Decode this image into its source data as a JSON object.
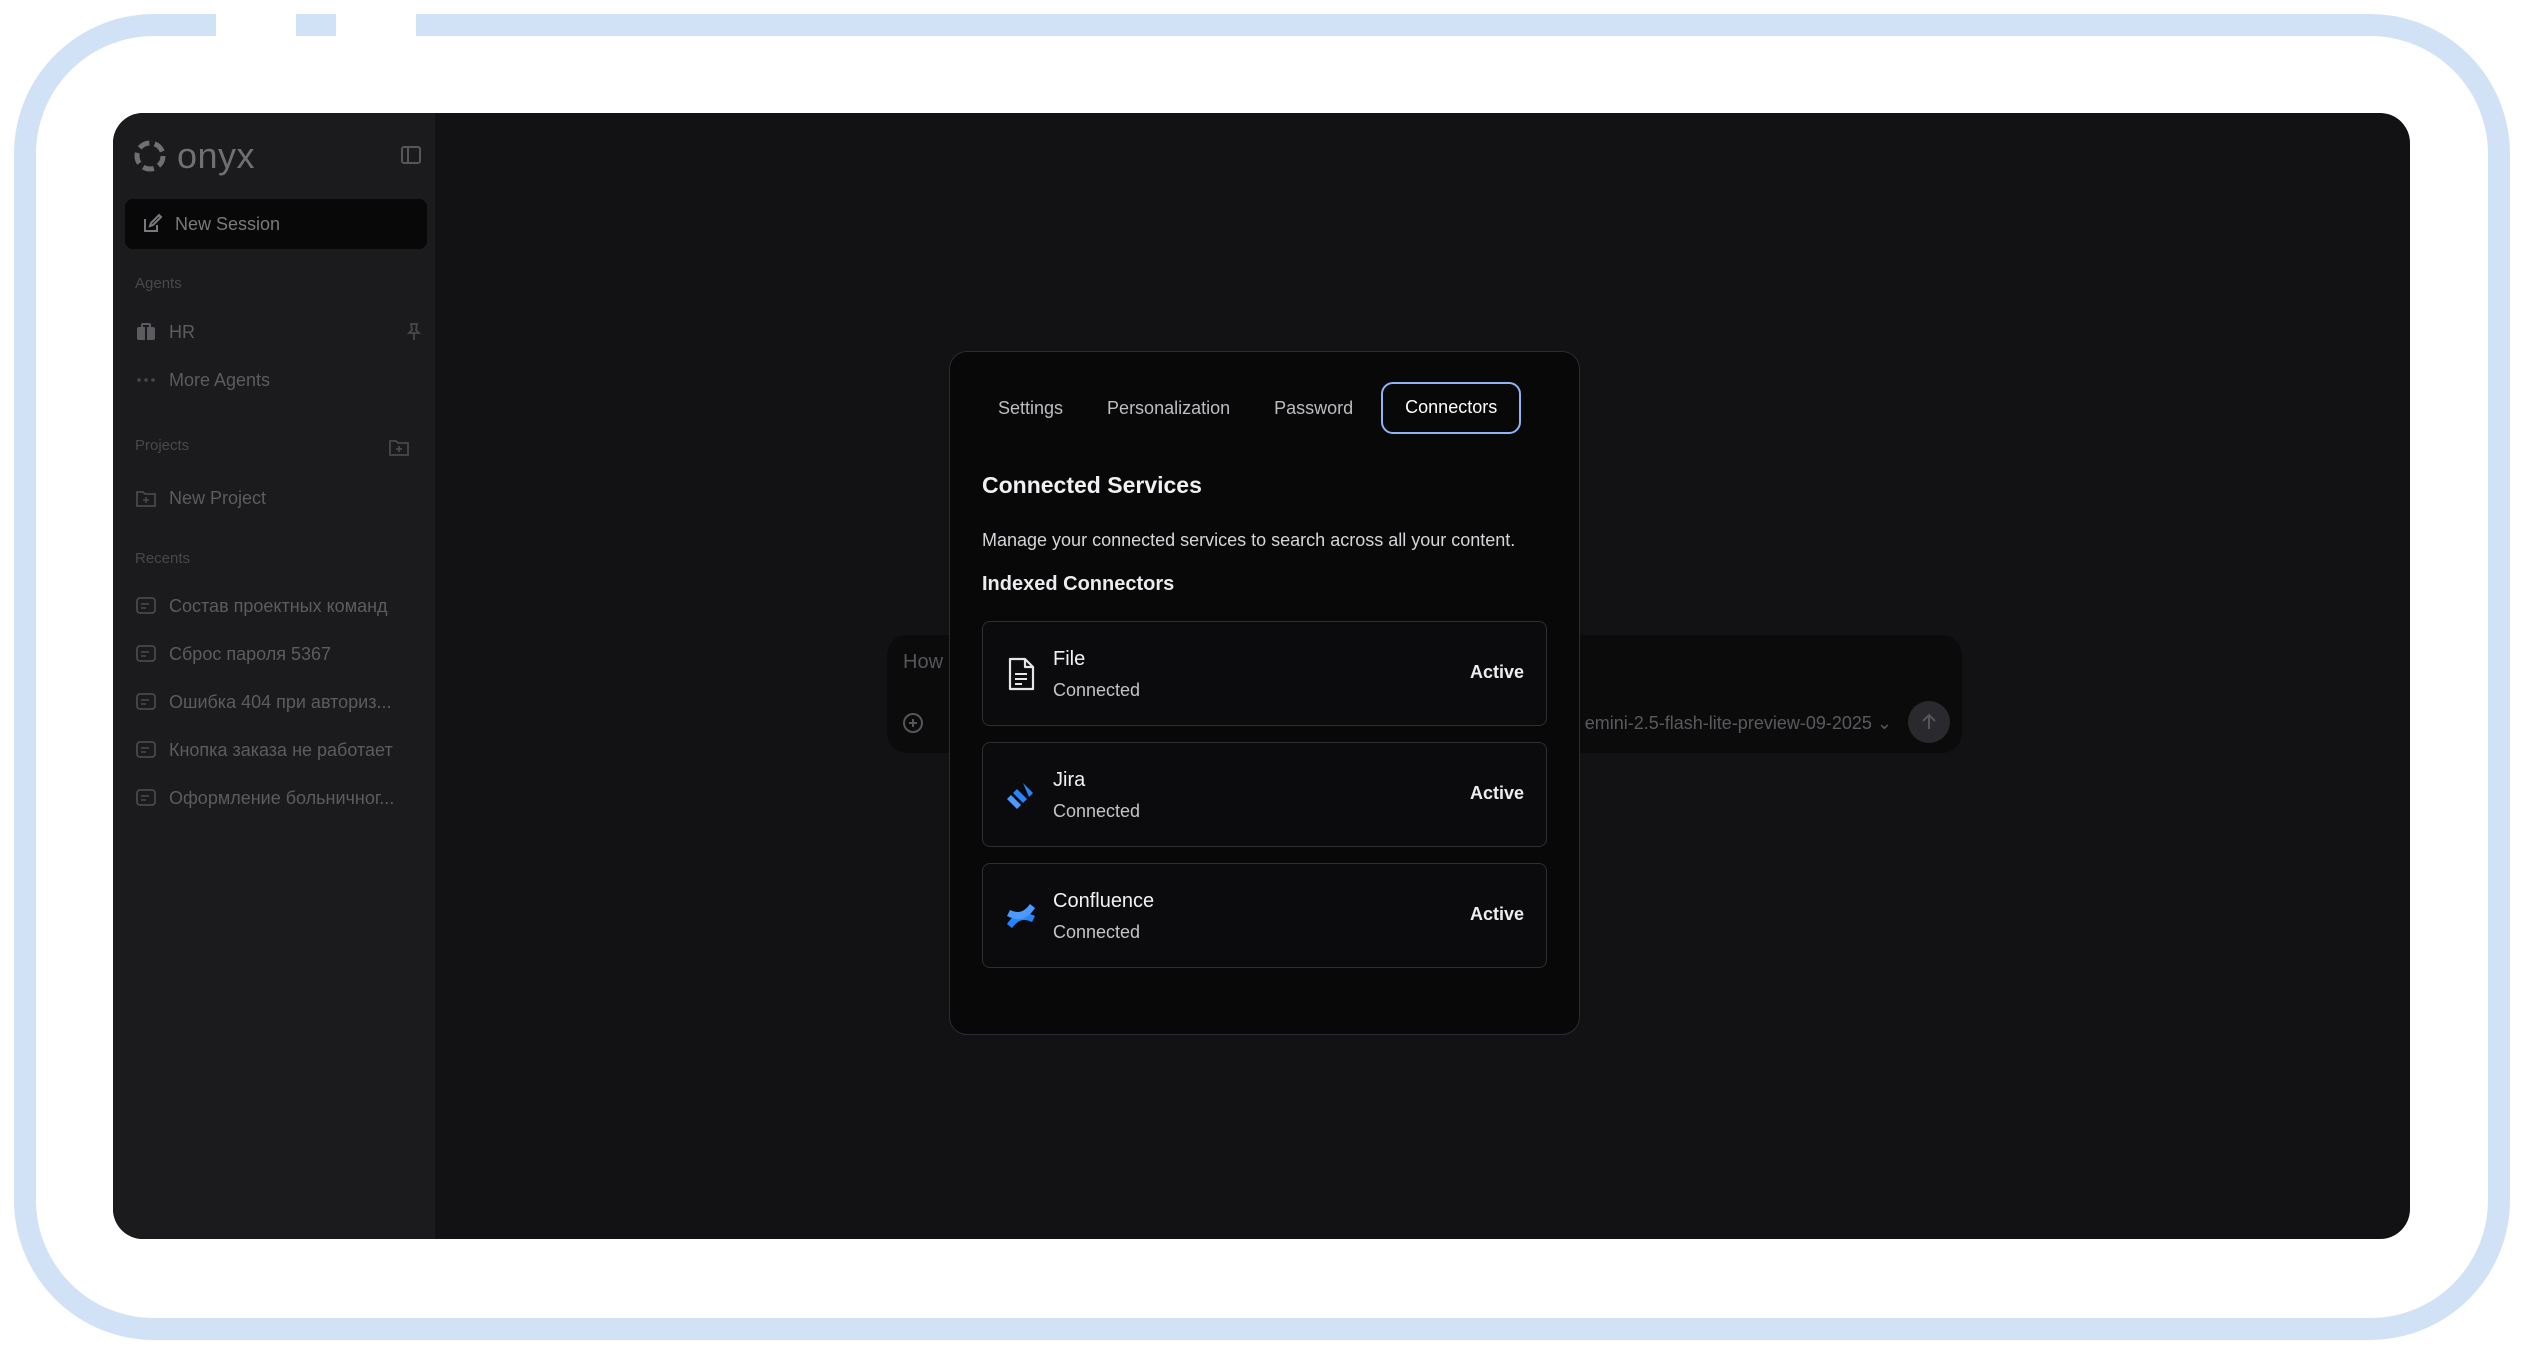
{
  "app": {
    "logo_text": "onyx"
  },
  "sidebar": {
    "new_session_label": "New Session",
    "agents_section": "Agents",
    "agents": [
      {
        "label": "HR",
        "icon": "hr-agent-icon"
      },
      {
        "label": "More Agents",
        "icon": "more-dots-icon"
      }
    ],
    "projects_section": "Projects",
    "new_project_label": "New Project",
    "recents_section": "Recents",
    "recents": [
      "Состав проектных команд",
      "Сброс пароля 5367",
      "Ошибка 404 при авториз...",
      "Кнопка заказа не работает",
      "Оформление больничног..."
    ]
  },
  "composer": {
    "placeholder": "How",
    "model": "emini-2.5-flash-lite-preview-09-2025"
  },
  "modal": {
    "tabs": [
      {
        "label": "Settings",
        "active": false
      },
      {
        "label": "Personalization",
        "active": false
      },
      {
        "label": "Password",
        "active": false
      },
      {
        "label": "Connectors",
        "active": true
      }
    ],
    "title": "Connected Services",
    "description": "Manage your connected services to search across all your content.",
    "section_title": "Indexed Connectors",
    "connectors": [
      {
        "name": "File",
        "status": "Connected",
        "badge": "Active",
        "icon": "file-icon"
      },
      {
        "name": "Jira",
        "status": "Connected",
        "badge": "Active",
        "icon": "jira-icon"
      },
      {
        "name": "Confluence",
        "status": "Connected",
        "badge": "Active",
        "icon": "confluence-icon"
      }
    ]
  },
  "colors": {
    "frame": "#d2e2f6",
    "app_bg": "#121214",
    "sidebar_bg": "#1b1b1e",
    "modal_bg": "#080809",
    "active_tab_border": "#8db4f4",
    "brand_blue": "#2684ff"
  }
}
